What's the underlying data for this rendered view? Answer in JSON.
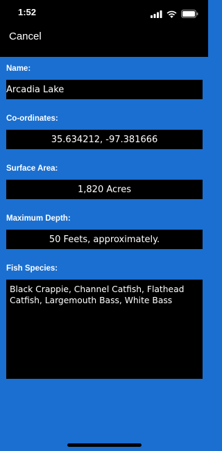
{
  "status_bar": {
    "time": "1:52",
    "icons": [
      "signal-icon",
      "wifi-icon",
      "battery-icon"
    ]
  },
  "nav": {
    "cancel_label": "Cancel"
  },
  "form": {
    "name": {
      "label": "Name:",
      "value": "Arcadia Lake"
    },
    "coordinates": {
      "label": "Co-ordinates:",
      "value": "35.634212, -97.381666"
    },
    "surface_area": {
      "label": "Surface Area:",
      "value": "1,820 Acres"
    },
    "max_depth": {
      "label": "Maximum Depth:",
      "value": "50 Feets, approximately."
    },
    "fish_species": {
      "label": "Fish Species:",
      "value": "Black Crappie, Channel Catfish, Flathead Catfish, Largemouth Bass, White Bass"
    }
  },
  "colors": {
    "background": "#1a6fd1",
    "field": "#000000",
    "text": "#ffffff"
  }
}
